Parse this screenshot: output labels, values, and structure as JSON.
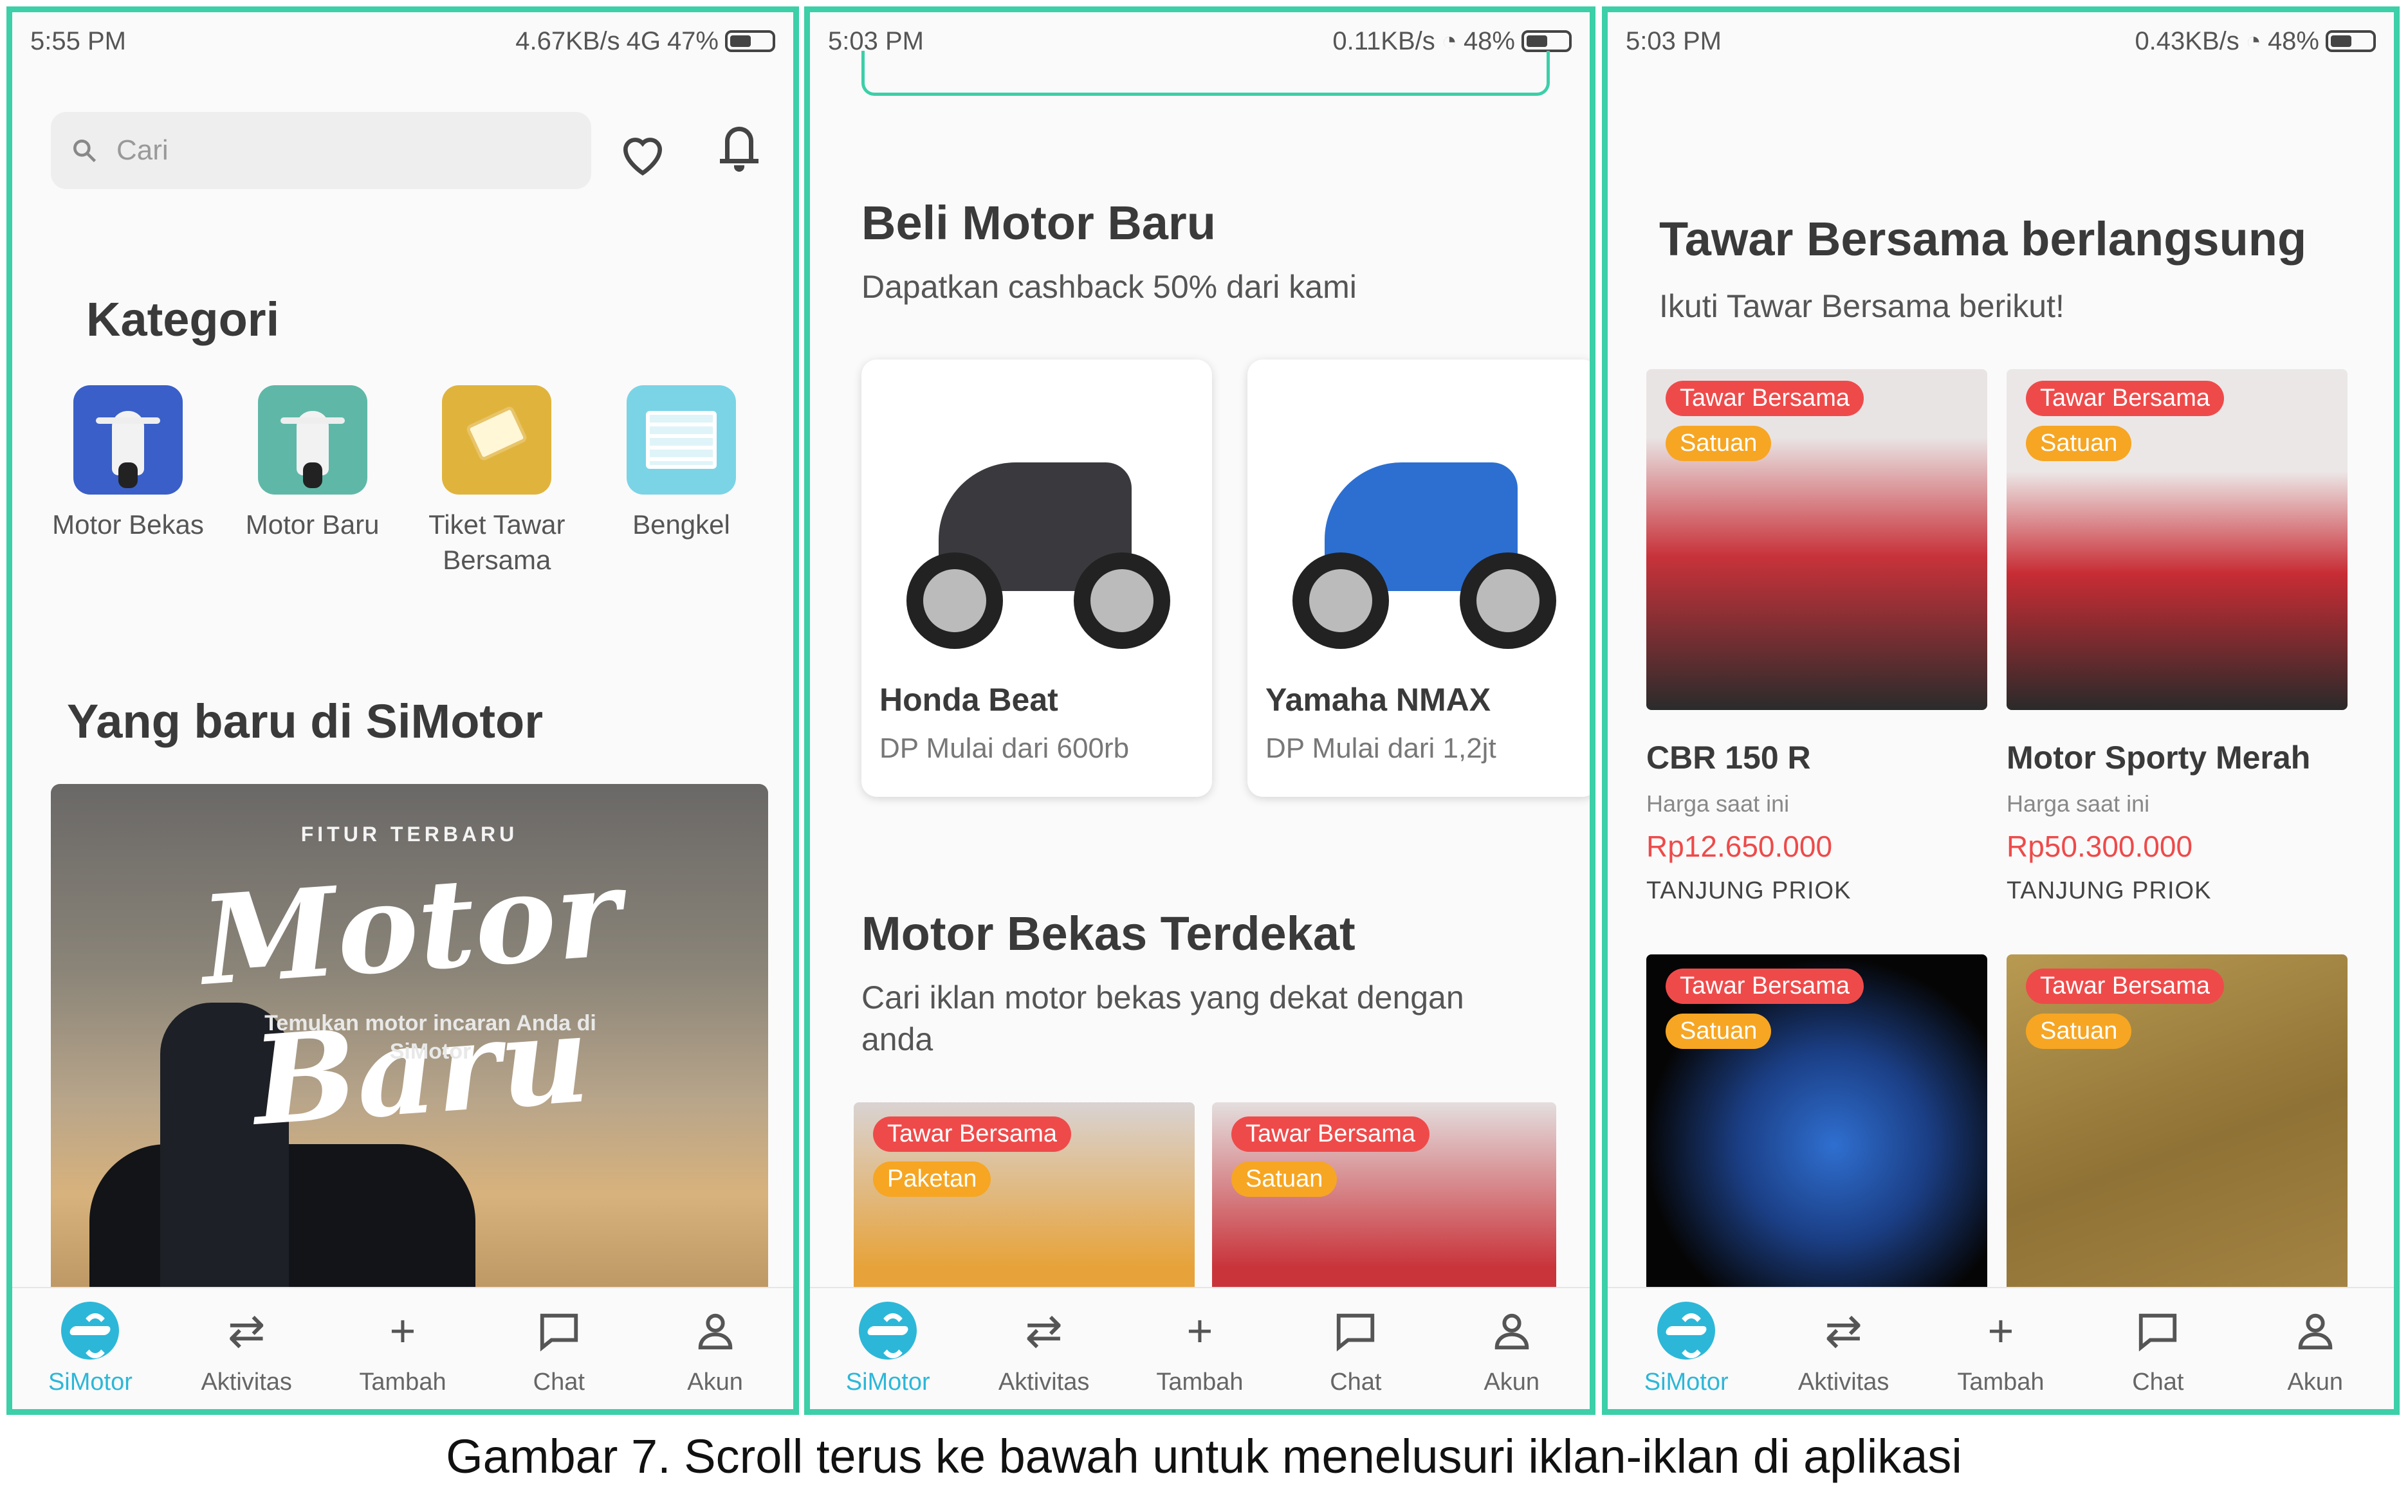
{
  "colors": {
    "accent": "#3ccfa8",
    "nav_active": "#2cb7d8",
    "price": "#ef4a4a",
    "badge_red": "#ef4a4a",
    "badge_orange": "#f6a623"
  },
  "screen1": {
    "status": {
      "time": "5:55 PM",
      "network": "4.67KB/s",
      "signal": "4G",
      "battery": "47%"
    },
    "search": {
      "placeholder": "Cari",
      "icon": "search-icon"
    },
    "kategori_title": "Kategori",
    "categories": [
      {
        "label": "Motor Bekas",
        "icon": "scooter-icon",
        "color": "#3a5fc8"
      },
      {
        "label": "Motor Baru",
        "icon": "scooter-icon",
        "color": "#5fb8a7"
      },
      {
        "label": "Tiket Tawar Bersama",
        "icon": "ticket-icon",
        "color": "#e0b43c"
      },
      {
        "label": "Bengkel",
        "icon": "garage-icon",
        "color": "#7ad4e6"
      }
    ],
    "new_title": "Yang baru di SiMotor",
    "banner": {
      "kicker": "FITUR TERBARU",
      "script": "Motor Baru",
      "tagline": "Temukan motor incaran Anda di SiMotor"
    }
  },
  "screen2": {
    "status": {
      "time": "5:03 PM",
      "network": "0.11KB/s",
      "battery": "48%"
    },
    "beli_title": "Beli Motor Baru",
    "beli_sub": "Dapatkan cashback 50% dari kami",
    "products": [
      {
        "name": "Honda Beat",
        "dp": "DP Mulai dari 600rb"
      },
      {
        "name": "Yamaha NMAX",
        "dp": "DP Mulai dari 1,2jt"
      }
    ],
    "bekas_title": "Motor Bekas Terdekat",
    "bekas_sub": "Cari iklan motor bekas yang dekat dengan anda",
    "listings": [
      {
        "badge1": "Tawar Bersama",
        "badge2": "Paketan"
      },
      {
        "badge1": "Tawar Bersama",
        "badge2": "Satuan"
      }
    ]
  },
  "screen3": {
    "status": {
      "time": "5:03 PM",
      "network": "0.43KB/s",
      "battery": "48%"
    },
    "title": "Tawar Bersama berlangsung",
    "sub": "Ikuti Tawar Bersama berikut!",
    "listings": [
      {
        "badge1": "Tawar Bersama",
        "badge2": "Satuan",
        "name": "CBR 150 R",
        "price_label": "Harga saat ini",
        "price": "Rp12.650.000",
        "location": "TANJUNG PRIOK"
      },
      {
        "badge1": "Tawar Bersama",
        "badge2": "Satuan",
        "name": "Motor Sporty Merah",
        "price_label": "Harga saat ini",
        "price": "Rp50.300.000",
        "location": "TANJUNG PRIOK"
      },
      {
        "badge1": "Tawar Bersama",
        "badge2": "Satuan"
      },
      {
        "badge1": "Tawar Bersama",
        "badge2": "Satuan"
      }
    ]
  },
  "nav": [
    {
      "label": "SiMotor",
      "icon": "simotor-logo-icon"
    },
    {
      "label": "Aktivitas",
      "icon": "arrows-exchange-icon"
    },
    {
      "label": "Tambah",
      "icon": "plus-icon"
    },
    {
      "label": "Chat",
      "icon": "chat-bubble-icon"
    },
    {
      "label": "Akun",
      "icon": "user-icon"
    }
  ],
  "caption": "Gambar 7. Scroll terus ke bawah untuk menelusuri iklan-iklan di aplikasi"
}
